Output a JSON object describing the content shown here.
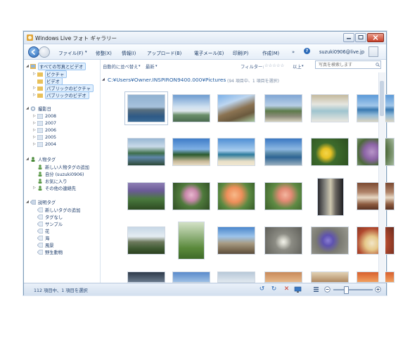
{
  "window": {
    "title": "Windows Live フォト ギャラリー"
  },
  "toolbar": {
    "menus": [
      "ファイル(F)",
      "修整(X)",
      "情報(I)",
      "アップロード(B)",
      "電子メール(E)",
      "印刷(P)",
      "作成(M)",
      "»"
    ],
    "account": "suzuki0906@live.jp"
  },
  "filterbar": {
    "sort": "自動的に並べ替え",
    "newest": "最新",
    "filter_label": "フィルター:",
    "rating_stars": "☆☆☆☆☆",
    "rating_suffix": "以上",
    "search_placeholder": "写真を検索します"
  },
  "path": {
    "text": "C:¥Users¥Owner.INSPIRON9400.000¥Pictures",
    "info": "(94 項目中、1 項目を選択)"
  },
  "sidebar": {
    "library": "すべての写真とビデオ",
    "library_items": [
      "ピクチャ",
      "ビデオ",
      "パブリックのピクチャ",
      "パブリックのビデオ"
    ],
    "date_header": "撮影日",
    "years": [
      "2008",
      "2007",
      "2006",
      "2005",
      "2004"
    ],
    "people_header": "人物タグ",
    "people_items": [
      "新しい人物タグの追加",
      "自分 (suzuki0906)",
      "お気に入り",
      "その他の連絡先"
    ],
    "desc_header": "説明タグ",
    "desc_items": [
      "新しいタグの追加",
      "タグなし",
      "サンプル",
      "花",
      "海",
      "風景",
      "野生動物"
    ]
  },
  "status": {
    "text": "112 項目中、1 項目を選択"
  },
  "colors": {
    "accent": "#1f5aa0",
    "selection": "#dfeefd"
  }
}
